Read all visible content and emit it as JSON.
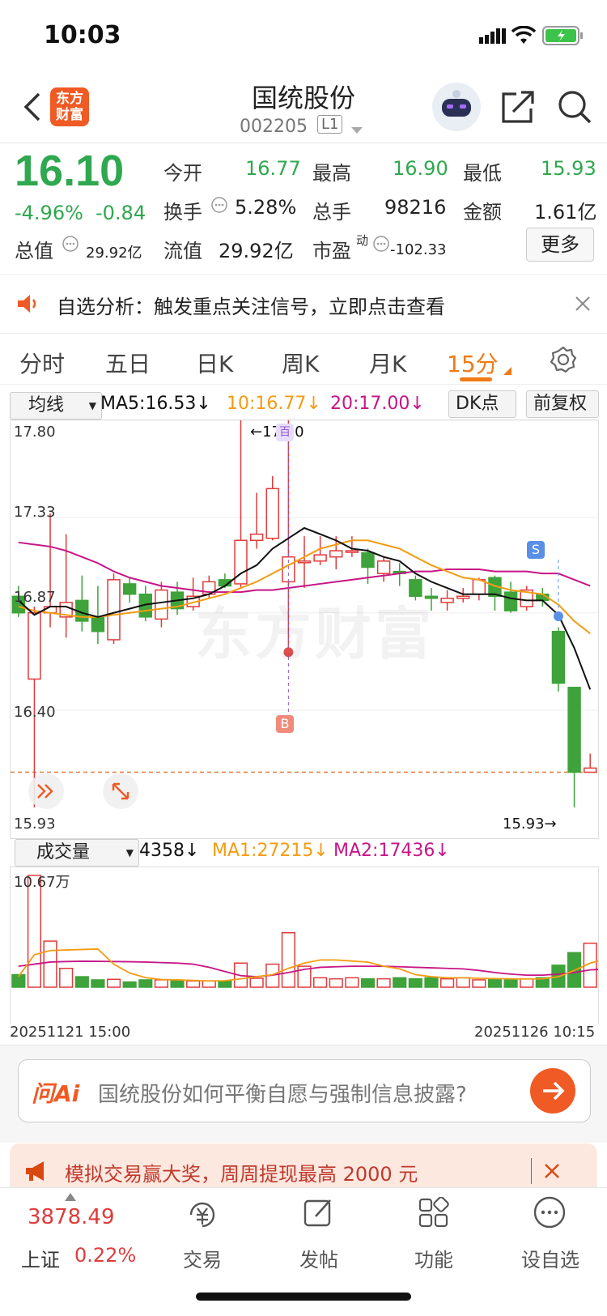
{
  "status": {
    "time": "10:03"
  },
  "header": {
    "title": "国统股份",
    "code": "002205",
    "level": "L1"
  },
  "quote": {
    "price": "16.10",
    "change_pct": "-4.96%",
    "change": "-0.84",
    "open_label": "今开",
    "open": "16.77",
    "high_label": "最高",
    "high": "16.90",
    "low_label": "最低",
    "low": "15.93",
    "turnover_label": "换手",
    "turnover": "5.28%",
    "volume_label": "总手",
    "volume": "98216",
    "amount_label": "金额",
    "amount": "1.61亿",
    "mktcap_label": "总值",
    "mktcap": "29.92亿",
    "float_label": "流值",
    "float": "29.92亿",
    "pe_label": "市盈",
    "pe_sup": "动",
    "pe": "-102.33",
    "more": "更多"
  },
  "notice": {
    "text": "自选分析：触发重点关注信号，立即点击查看"
  },
  "tabs": [
    {
      "label": "分时"
    },
    {
      "label": "五日"
    },
    {
      "label": "日K"
    },
    {
      "label": "周K"
    },
    {
      "label": "月K"
    },
    {
      "label": "15分"
    }
  ],
  "kline": {
    "select": "均线",
    "ma5": "MA5:16.53↓",
    "ma10": "10:16.77↓",
    "ma20": "20:17.00↓",
    "dk": "DK点",
    "fq": "前复权",
    "y_labels": [
      "17.80",
      "17.33",
      "16.87",
      "16.40",
      "15.93"
    ],
    "high_mark": "←17.80",
    "low_mark": "15.93→",
    "watermark": "东方财富",
    "b_label": "B",
    "s_label": "S",
    "top_label": "百"
  },
  "volume": {
    "select": "成交量",
    "v": "4358↓",
    "ma1": "MA1:27215↓",
    "ma2": "MA2:17436↓",
    "max_label": "10.67万",
    "date_left": "20251121 15:00",
    "date_right": "20251126 10:15"
  },
  "chart_data": {
    "type": "candlestick",
    "y_range": [
      15.93,
      17.8
    ],
    "candles": [
      {
        "o": 16.95,
        "c": 16.87,
        "h": 17.0,
        "l": 16.85
      },
      {
        "o": 16.55,
        "c": 16.87,
        "h": 16.9,
        "l": 15.93
      },
      {
        "o": 16.87,
        "c": 16.9,
        "h": 17.35,
        "l": 16.8
      },
      {
        "o": 16.85,
        "c": 16.92,
        "h": 17.25,
        "l": 16.75
      },
      {
        "o": 16.93,
        "c": 16.83,
        "h": 17.05,
        "l": 16.78
      },
      {
        "o": 16.85,
        "c": 16.78,
        "h": 17.0,
        "l": 16.72
      },
      {
        "o": 16.74,
        "c": 17.03,
        "h": 17.06,
        "l": 16.72
      },
      {
        "o": 17.01,
        "c": 16.96,
        "h": 17.04,
        "l": 16.92
      },
      {
        "o": 16.96,
        "c": 16.85,
        "h": 17.0,
        "l": 16.83
      },
      {
        "o": 16.84,
        "c": 16.98,
        "h": 17.02,
        "l": 16.8
      },
      {
        "o": 16.97,
        "c": 16.89,
        "h": 17.02,
        "l": 16.86
      },
      {
        "o": 16.9,
        "c": 16.95,
        "h": 17.04,
        "l": 16.88
      },
      {
        "o": 16.96,
        "c": 17.02,
        "h": 17.05,
        "l": 16.94
      },
      {
        "o": 17.03,
        "c": 17.0,
        "h": 17.06,
        "l": 16.99
      },
      {
        "o": 17.01,
        "c": 17.22,
        "h": 17.8,
        "l": 16.99
      },
      {
        "o": 17.22,
        "c": 17.25,
        "h": 17.45,
        "l": 17.18
      },
      {
        "o": 17.23,
        "c": 17.47,
        "h": 17.53,
        "l": 17.22
      },
      {
        "o": 17.02,
        "c": 17.14,
        "h": 17.8,
        "l": 16.68
      },
      {
        "o": 17.12,
        "c": 17.12,
        "h": 17.24,
        "l": 16.99
      },
      {
        "o": 17.12,
        "c": 17.15,
        "h": 17.24,
        "l": 17.1
      },
      {
        "o": 17.14,
        "c": 17.17,
        "h": 17.24,
        "l": 17.08
      },
      {
        "o": 17.17,
        "c": 17.17,
        "h": 17.24,
        "l": 17.14
      },
      {
        "o": 17.16,
        "c": 17.09,
        "h": 17.18,
        "l": 17.01
      },
      {
        "o": 17.06,
        "c": 17.12,
        "h": 17.14,
        "l": 17.02
      },
      {
        "o": 17.07,
        "c": 17.06,
        "h": 17.11,
        "l": 17.0
      },
      {
        "o": 17.03,
        "c": 16.95,
        "h": 17.05,
        "l": 16.93
      },
      {
        "o": 16.95,
        "c": 16.94,
        "h": 16.99,
        "l": 16.88
      },
      {
        "o": 16.92,
        "c": 16.94,
        "h": 16.98,
        "l": 16.88
      },
      {
        "o": 16.94,
        "c": 16.95,
        "h": 16.99,
        "l": 16.92
      },
      {
        "o": 16.96,
        "c": 17.03,
        "h": 17.04,
        "l": 16.93
      },
      {
        "o": 17.04,
        "c": 16.95,
        "h": 17.05,
        "l": 16.88
      },
      {
        "o": 16.97,
        "c": 16.88,
        "h": 17.02,
        "l": 16.87
      },
      {
        "o": 16.9,
        "c": 16.98,
        "h": 17.0,
        "l": 16.88
      },
      {
        "o": 16.96,
        "c": 16.93,
        "h": 16.99,
        "l": 16.9
      },
      {
        "o": 16.78,
        "c": 16.53,
        "h": 16.8,
        "l": 16.49
      },
      {
        "o": 16.51,
        "c": 16.1,
        "h": 16.51,
        "l": 15.93
      },
      {
        "o": 16.1,
        "c": 16.12,
        "h": 16.19,
        "l": 16.1
      }
    ],
    "ma5": [
      16.93,
      16.86,
      16.9,
      16.9,
      16.87,
      16.85,
      16.87,
      16.89,
      16.91,
      16.92,
      16.93,
      16.94,
      16.96,
      17.0,
      17.06,
      17.1,
      17.18,
      17.23,
      17.28,
      17.25,
      17.22,
      17.18,
      17.17,
      17.14,
      17.12,
      17.06,
      17.02,
      16.99,
      16.96,
      16.96,
      16.96,
      16.94,
      16.93,
      16.93,
      16.86,
      16.7,
      16.5
    ],
    "ma10": [
      16.9,
      16.88,
      16.87,
      16.86,
      16.85,
      16.85,
      16.86,
      16.87,
      16.88,
      16.89,
      16.9,
      16.92,
      16.94,
      16.96,
      16.99,
      17.02,
      17.06,
      17.1,
      17.14,
      17.18,
      17.2,
      17.22,
      17.22,
      17.2,
      17.18,
      17.14,
      17.1,
      17.07,
      17.04,
      17.03,
      17.0,
      16.98,
      16.97,
      16.96,
      16.91,
      16.83,
      16.77
    ],
    "ma20": [
      17.21,
      17.2,
      17.19,
      17.17,
      17.14,
      17.11,
      17.07,
      17.04,
      17.02,
      17.0,
      16.99,
      16.98,
      16.97,
      16.97,
      16.97,
      16.98,
      16.98,
      16.99,
      17.0,
      17.01,
      17.02,
      17.03,
      17.04,
      17.05,
      17.06,
      17.07,
      17.07,
      17.08,
      17.08,
      17.08,
      17.07,
      17.07,
      17.07,
      17.06,
      17.06,
      17.03,
      17.0
    ],
    "volume": [
      12000,
      106700,
      44000,
      18000,
      10000,
      7000,
      7500,
      5000,
      7000,
      7000,
      6000,
      6000,
      6000,
      6000,
      23000,
      8500,
      22000,
      52000,
      20000,
      9000,
      8000,
      9000,
      8000,
      8000,
      9000,
      8000,
      9000,
      8000,
      9000,
      7000,
      8000,
      7000,
      8000,
      9000,
      21000,
      33000,
      42000,
      4358
    ],
    "vol_ma1": [
      10000,
      31000,
      35000,
      35500,
      36000,
      36500,
      22000,
      13500,
      9200,
      7300,
      7000,
      6500,
      6000,
      6200,
      8000,
      10000,
      12000,
      18000,
      23000,
      26000,
      26000,
      25000,
      24000,
      20000,
      17500,
      12000,
      10000,
      9000,
      9000,
      8500,
      8200,
      8000,
      7800,
      8000,
      10000,
      16000,
      23000,
      27215
    ],
    "vol_ma2": [
      20000,
      22000,
      24000,
      24500,
      24800,
      24700,
      24500,
      24300,
      24000,
      23500,
      23000,
      22000,
      19000,
      15000,
      11000,
      10000,
      11500,
      14000,
      17000,
      19000,
      19500,
      20000,
      20000,
      20000,
      19500,
      19000,
      18500,
      18000,
      17500,
      16000,
      14000,
      12500,
      11500,
      11500,
      12500,
      14000,
      16500,
      17436
    ]
  },
  "ask": {
    "logo": "问Ai",
    "text": "国统股份如何平衡自愿与强制信息披露?"
  },
  "banner": {
    "text": "模拟交易赢大奖，周周提现最高 2000 元"
  },
  "bottom": {
    "index_value": "3878.49",
    "index_name": "上证",
    "index_pct": "0.22%",
    "nav": [
      {
        "label": "交易"
      },
      {
        "label": "发帖"
      },
      {
        "label": "功能"
      },
      {
        "label": "设自选"
      }
    ]
  }
}
